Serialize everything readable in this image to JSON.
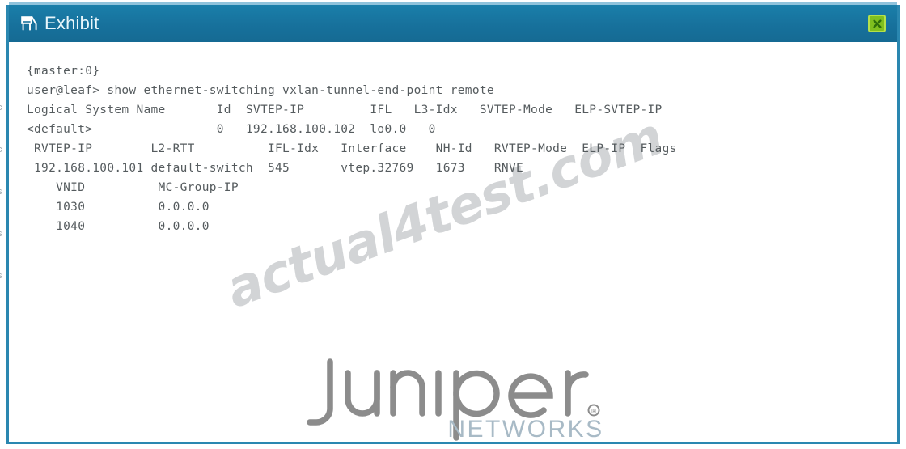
{
  "window": {
    "title": "Exhibit",
    "title_icon": "exhibit-easel-icon",
    "close_icon": "close-x-icon",
    "header_color": "#17719c",
    "border_color": "#2a87b0",
    "title_text_color": "#e8f6fb",
    "close_button_fill": "#7fbf1f",
    "close_button_border": "#b4e04a"
  },
  "terminal": {
    "text_color": "#555b5e",
    "lines": [
      "{master:0}",
      "user@leaf> show ethernet-switching vxlan-tunnel-end-point remote",
      "Logical System Name       Id  SVTEP-IP         IFL   L3-Idx   SVTEP-Mode   ELP-SVTEP-IP",
      "<default>                 0   192.168.100.102  lo0.0   0",
      " RVTEP-IP        L2-RTT          IFL-Idx   Interface    NH-Id   RVTEP-Mode  ELP-IP  Flags",
      " 192.168.100.101 default-switch  545       vtep.32769   1673    RNVE",
      "    VNID          MC-Group-IP",
      "    1030          0.0.0.0",
      "    1040          0.0.0.0"
    ],
    "command": {
      "prompt": "user@leaf>",
      "command": "show ethernet-switching vxlan-tunnel-end-point remote",
      "mode_banner": "{master:0}"
    },
    "tables": [
      {
        "name": "logical-system-table",
        "headers": [
          "Logical System Name",
          "Id",
          "SVTEP-IP",
          "IFL",
          "L3-Idx",
          "SVTEP-Mode",
          "ELP-SVTEP-IP"
        ],
        "rows": [
          [
            "<default>",
            "0",
            "192.168.100.102",
            "lo0.0",
            "0",
            "",
            ""
          ]
        ]
      },
      {
        "name": "rvtep-table",
        "headers": [
          "RVTEP-IP",
          "L2-RTT",
          "IFL-Idx",
          "Interface",
          "NH-Id",
          "RVTEP-Mode",
          "ELP-IP",
          "Flags"
        ],
        "rows": [
          [
            "192.168.100.101",
            "default-switch",
            "545",
            "vtep.32769",
            "1673",
            "RNVE",
            "",
            ""
          ]
        ]
      },
      {
        "name": "vnid-table",
        "headers": [
          "VNID",
          "MC-Group-IP"
        ],
        "rows": [
          [
            "1030",
            "0.0.0.0"
          ],
          [
            "1040",
            "0.0.0.0"
          ]
        ]
      }
    ]
  },
  "watermark": {
    "text": "actual4test.com",
    "color": "#d2d4d6"
  },
  "logo": {
    "wordmark": "juniper",
    "tagline": "NETWORKS",
    "registered_mark": "®",
    "wordmark_color": "#8c8c8c",
    "tagline_color": "#a8bac6"
  },
  "margin_artifacts": [
    "c",
    "c",
    "s",
    "s",
    "s",
    "s"
  ]
}
